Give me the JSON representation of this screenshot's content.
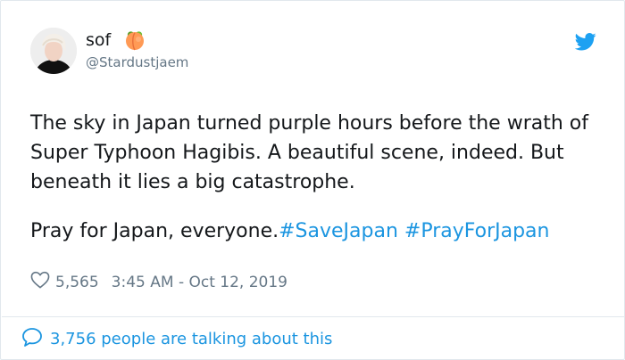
{
  "tweet": {
    "author_name": "sof",
    "author_emoji": "peach-emoji",
    "handle": "@Stardustjaem",
    "text_line1": "The sky in Japan turned purple hours before the wrath of Super Typhoon Hagibis. A beautiful scene, indeed. But beneath it lies a big catastrophe.",
    "text_line2_prefix": "Pray for Japan, everyone.",
    "hashtags": [
      "#SaveJapan",
      "#PrayForJapan"
    ],
    "likes": "5,565",
    "timestamp": "3:45 AM - Oct 12, 2019",
    "talking": "3,756 people are talking about this"
  },
  "icons": {
    "platform": "twitter-bird-icon",
    "like": "heart-icon",
    "reply": "speech-bubble-icon"
  },
  "colors": {
    "link": "#1b95e0",
    "secondary_text": "#657786",
    "border": "#e1e8ed",
    "bird": "#1da1f2"
  }
}
